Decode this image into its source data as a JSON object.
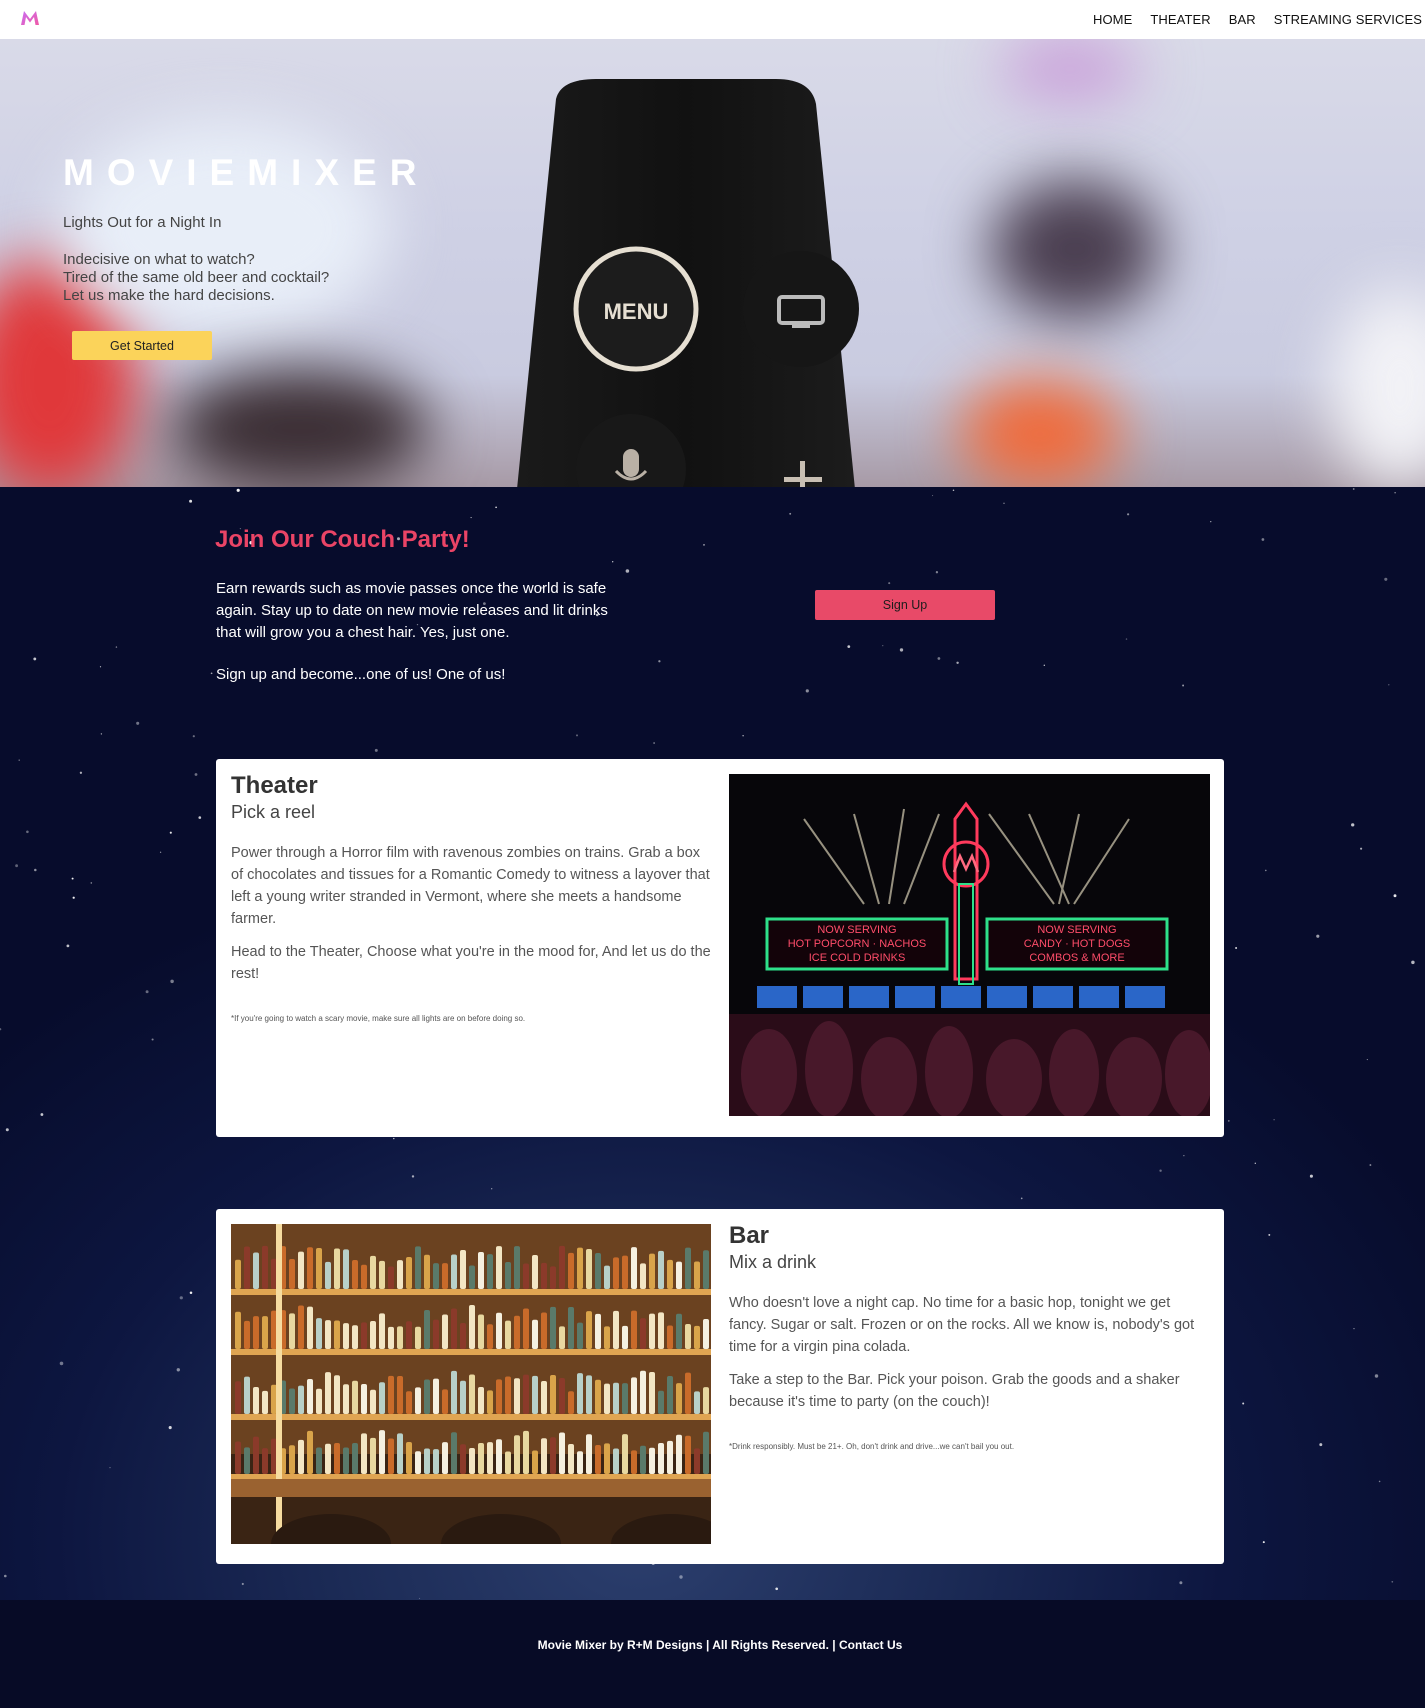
{
  "nav": {
    "logo_letter": "M",
    "links": [
      "HOME",
      "THEATER",
      "BAR",
      "STREAMING SERVICES"
    ]
  },
  "hero": {
    "title": "MOVIEMIXER",
    "tagline": "Lights Out for a Night In",
    "lines": [
      "Indecisive on what to watch?",
      "Tired of the same old beer and cocktail?",
      "Let us make the hard decisions."
    ],
    "button": "Get Started",
    "remote_menu_label": "MENU"
  },
  "join": {
    "title": "Join Our Couch Party!",
    "paragraph1": "Earn rewards such as movie passes once the world is safe again. Stay up to date on new movie releases and lit drinks that will grow you a chest hair. Yes, just one.",
    "paragraph2": "Sign up and become...one of us! One of us!",
    "button": "Sign Up"
  },
  "theater": {
    "title": "Theater",
    "subtitle": "Pick a reel",
    "paragraph1": "Power through a Horror film with ravenous zombies on trains. Grab a box of chocolates and tissues for a Romantic Comedy to witness a layover that left a young writer stranded in Vermont, where she meets a handsome farmer.",
    "paragraph2": "Head to the Theater, Choose what you're in the mood for, And let us do the rest!",
    "note": "*If you're going to watch a scary movie, make sure all lights are on before doing so.",
    "sign_left": [
      "NOW SERVING",
      "HOT POPCORN · NACHOS",
      "ICE COLD DRINKS"
    ],
    "sign_right": [
      "NOW SERVING",
      "CANDY · HOT DOGS",
      "COMBOS & MORE"
    ]
  },
  "bar": {
    "title": "Bar",
    "subtitle": "Mix a drink",
    "paragraph1": "Who doesn't love a night cap. No time for a basic hop, tonight we get fancy. Sugar or salt. Frozen or on the rocks. All we know is, nobody's got time for a virgin pina colada.",
    "paragraph2": "Take a step to the Bar. Pick your poison. Grab the goods and a shaker because it's time to party (on the couch)!",
    "note": "*Drink responsibly. Must be 21+. Oh, don't drink and drive...we can't bail you out."
  },
  "footer": {
    "text": "Movie Mixer by R+M Designs | All Rights Reserved. | Contact Us"
  },
  "colors": {
    "accent_pink": "#ea4466",
    "button_yellow": "#fbd35a",
    "signup_pink": "#e84a68",
    "footer_bg": "#070b26"
  }
}
